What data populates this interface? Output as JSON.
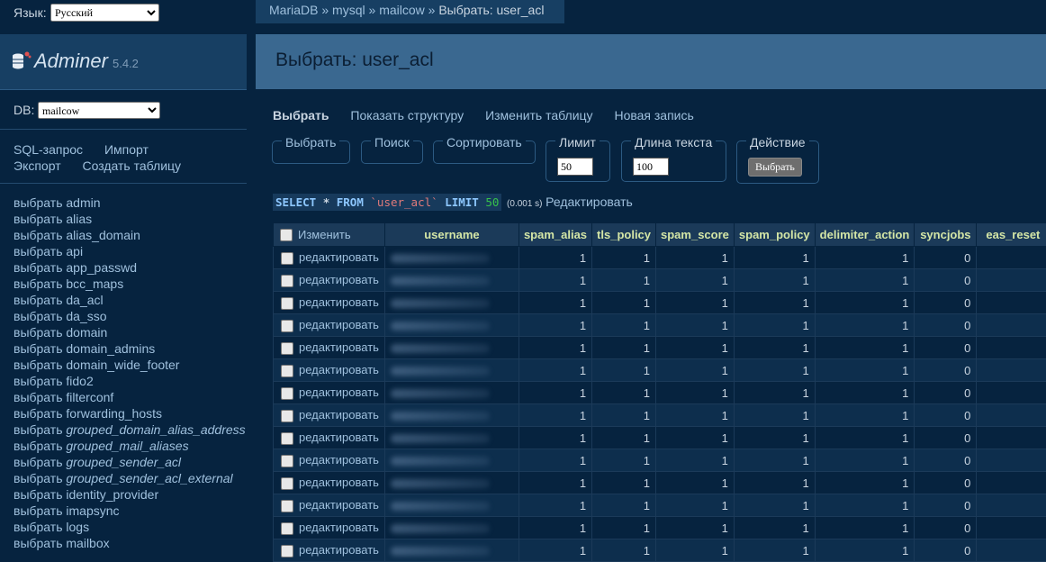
{
  "language": {
    "label": "Язык:",
    "selected": "Русский"
  },
  "app": {
    "name": "Adminer",
    "version": "5.4.2"
  },
  "db": {
    "label": "DB:",
    "selected": "mailcow"
  },
  "menu": {
    "sql": "SQL-запрос",
    "import": "Импорт",
    "export": "Экспорт",
    "create": "Создать таблицу"
  },
  "tables_prefix": "выбрать",
  "tables": [
    {
      "name": "admin",
      "view": false
    },
    {
      "name": "alias",
      "view": false
    },
    {
      "name": "alias_domain",
      "view": false
    },
    {
      "name": "api",
      "view": false
    },
    {
      "name": "app_passwd",
      "view": false
    },
    {
      "name": "bcc_maps",
      "view": false
    },
    {
      "name": "da_acl",
      "view": false
    },
    {
      "name": "da_sso",
      "view": false
    },
    {
      "name": "domain",
      "view": false
    },
    {
      "name": "domain_admins",
      "view": false
    },
    {
      "name": "domain_wide_footer",
      "view": false
    },
    {
      "name": "fido2",
      "view": false
    },
    {
      "name": "filterconf",
      "view": false
    },
    {
      "name": "forwarding_hosts",
      "view": false
    },
    {
      "name": "grouped_domain_alias_address",
      "view": true
    },
    {
      "name": "grouped_mail_aliases",
      "view": true
    },
    {
      "name": "grouped_sender_acl",
      "view": true
    },
    {
      "name": "grouped_sender_acl_external",
      "view": true
    },
    {
      "name": "identity_provider",
      "view": false
    },
    {
      "name": "imapsync",
      "view": false
    },
    {
      "name": "logs",
      "view": false
    },
    {
      "name": "mailbox",
      "view": false
    }
  ],
  "breadcrumb": {
    "server": "MariaDB",
    "sep": "»",
    "db1": "mysql",
    "db2": "mailcow",
    "current": "Выбрать: user_acl"
  },
  "page_title": "Выбрать: user_acl",
  "tabs": {
    "select": "Выбрать",
    "structure": "Показать структуру",
    "alter": "Изменить таблицу",
    "new": "Новая запись"
  },
  "fieldsets": {
    "select": "Выбрать",
    "search": "Поиск",
    "sort": "Сортировать",
    "limit": {
      "label": "Лимит",
      "value": "50"
    },
    "text_length": {
      "label": "Длина текста",
      "value": "100"
    },
    "action": {
      "label": "Действие",
      "button": "Выбрать"
    }
  },
  "sql": {
    "select": "SELECT",
    "star": "*",
    "from": "FROM",
    "table": "`user_acl`",
    "limit_kw": "LIMIT",
    "limit": "50",
    "time": "(0.001 s)",
    "edit": "Редактировать"
  },
  "grid": {
    "edit_header": "Изменить",
    "columns": [
      "username",
      "spam_alias",
      "tls_policy",
      "spam_score",
      "spam_policy",
      "delimiter_action",
      "syncjobs",
      "eas_reset"
    ],
    "row_edit": "редактировать",
    "rows": [
      [
        "1",
        "1",
        "1",
        "1",
        "1",
        "0"
      ],
      [
        "1",
        "1",
        "1",
        "1",
        "1",
        "0"
      ],
      [
        "1",
        "1",
        "1",
        "1",
        "1",
        "0"
      ],
      [
        "1",
        "1",
        "1",
        "1",
        "1",
        "0"
      ],
      [
        "1",
        "1",
        "1",
        "1",
        "1",
        "0"
      ],
      [
        "1",
        "1",
        "1",
        "1",
        "1",
        "0"
      ],
      [
        "1",
        "1",
        "1",
        "1",
        "1",
        "0"
      ],
      [
        "1",
        "1",
        "1",
        "1",
        "1",
        "0"
      ],
      [
        "1",
        "1",
        "1",
        "1",
        "1",
        "0"
      ],
      [
        "1",
        "1",
        "1",
        "1",
        "1",
        "0"
      ],
      [
        "1",
        "1",
        "1",
        "1",
        "1",
        "0"
      ],
      [
        "1",
        "1",
        "1",
        "1",
        "1",
        "0"
      ],
      [
        "1",
        "1",
        "1",
        "1",
        "1",
        "0"
      ],
      [
        "1",
        "1",
        "1",
        "1",
        "1",
        "0"
      ]
    ]
  }
}
